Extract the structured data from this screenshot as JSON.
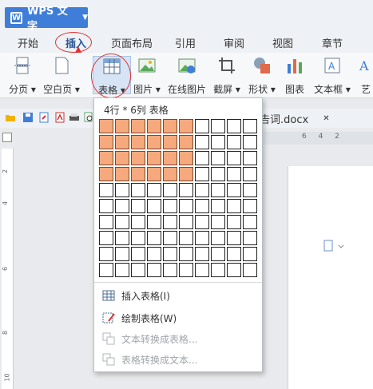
{
  "app": {
    "title": "WPS 文字",
    "logo": "W"
  },
  "tabs": [
    "开始",
    "插入",
    "页面布局",
    "引用",
    "审阅",
    "视图",
    "章节"
  ],
  "active_tab": "插入",
  "ribbon": {
    "buttons": [
      {
        "label": "分页",
        "icon": "page-break-icon"
      },
      {
        "label": "空白页",
        "icon": "blank-page-icon"
      },
      {
        "label": "表格",
        "icon": "table-icon"
      },
      {
        "label": "图片",
        "icon": "picture-icon"
      },
      {
        "label": "在线图片",
        "icon": "online-picture-icon"
      },
      {
        "label": "截屏",
        "icon": "screenshot-icon"
      },
      {
        "label": "形状",
        "icon": "shape-icon"
      },
      {
        "label": "图表",
        "icon": "chart-icon"
      },
      {
        "label": "文本框",
        "icon": "textbox-icon"
      },
      {
        "label": "艺",
        "icon": "art-text-icon"
      }
    ]
  },
  "document": {
    "tab_label": "告词.docx"
  },
  "ruler": {
    "h_numbers": "6 4 2",
    "v_numbers": [
      "2",
      "4",
      "6",
      "8",
      "10"
    ]
  },
  "table_dropdown": {
    "header": "4行 * 6列 表格",
    "grid_rows": 10,
    "grid_cols": 10,
    "selected_rows": 4,
    "selected_cols": 6,
    "menu": [
      {
        "label": "插入表格(I)",
        "enabled": true,
        "icon": "insert-table-icon"
      },
      {
        "label": "绘制表格(W)",
        "enabled": true,
        "icon": "draw-table-icon"
      },
      {
        "label": "文本转换成表格...",
        "enabled": false,
        "icon": "text-to-table-icon"
      },
      {
        "label": "表格转换成文本...",
        "enabled": false,
        "icon": "table-to-text-icon"
      }
    ]
  },
  "colors": {
    "accent": "#3f7ed8",
    "selected_cell": "#f5a97c",
    "annotation": "#e0302f"
  }
}
